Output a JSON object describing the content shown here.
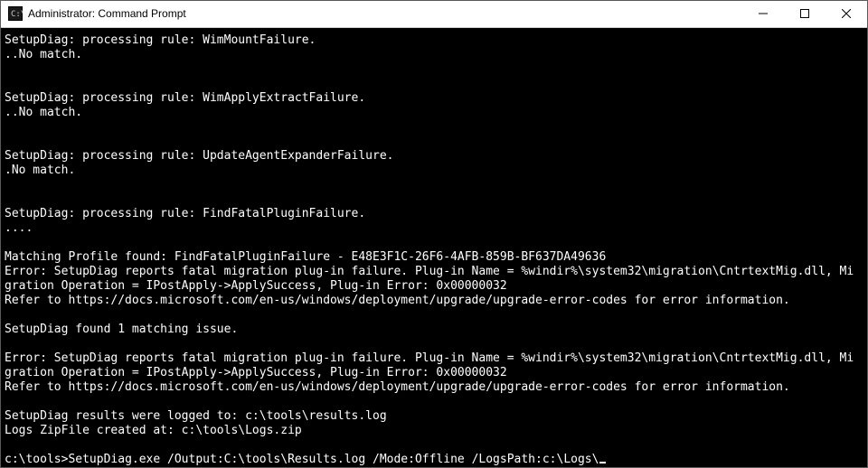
{
  "titlebar": {
    "icon_label": "cmd-icon",
    "title": "Administrator: Command Prompt",
    "minimize_label": "Minimize",
    "maximize_label": "Maximize",
    "close_label": "Close"
  },
  "console": {
    "lines": [
      "SetupDiag: processing rule: WimMountFailure.",
      "..No match.",
      "",
      "",
      "SetupDiag: processing rule: WimApplyExtractFailure.",
      "..No match.",
      "",
      "",
      "SetupDiag: processing rule: UpdateAgentExpanderFailure.",
      ".No match.",
      "",
      "",
      "SetupDiag: processing rule: FindFatalPluginFailure.",
      "....",
      "",
      "Matching Profile found: FindFatalPluginFailure - E48E3F1C-26F6-4AFB-859B-BF637DA49636",
      "Error: SetupDiag reports fatal migration plug-in failure. Plug-in Name = %windir%\\system32\\migration\\CntrtextMig.dll, Mi",
      "gration Operation = IPostApply->ApplySuccess, Plug-in Error: 0x00000032",
      "Refer to https://docs.microsoft.com/en-us/windows/deployment/upgrade/upgrade-error-codes for error information.",
      "",
      "SetupDiag found 1 matching issue.",
      "",
      "Error: SetupDiag reports fatal migration plug-in failure. Plug-in Name = %windir%\\system32\\migration\\CntrtextMig.dll, Mi",
      "gration Operation = IPostApply->ApplySuccess, Plug-in Error: 0x00000032",
      "Refer to https://docs.microsoft.com/en-us/windows/deployment/upgrade/upgrade-error-codes for error information.",
      "",
      "SetupDiag results were logged to: c:\\tools\\results.log",
      "Logs ZipFile created at: c:\\tools\\Logs.zip",
      ""
    ],
    "prompt": "c:\\tools>",
    "command": "SetupDiag.exe /Output:C:\\tools\\Results.log /Mode:Offline /LogsPath:c:\\Logs\\"
  }
}
